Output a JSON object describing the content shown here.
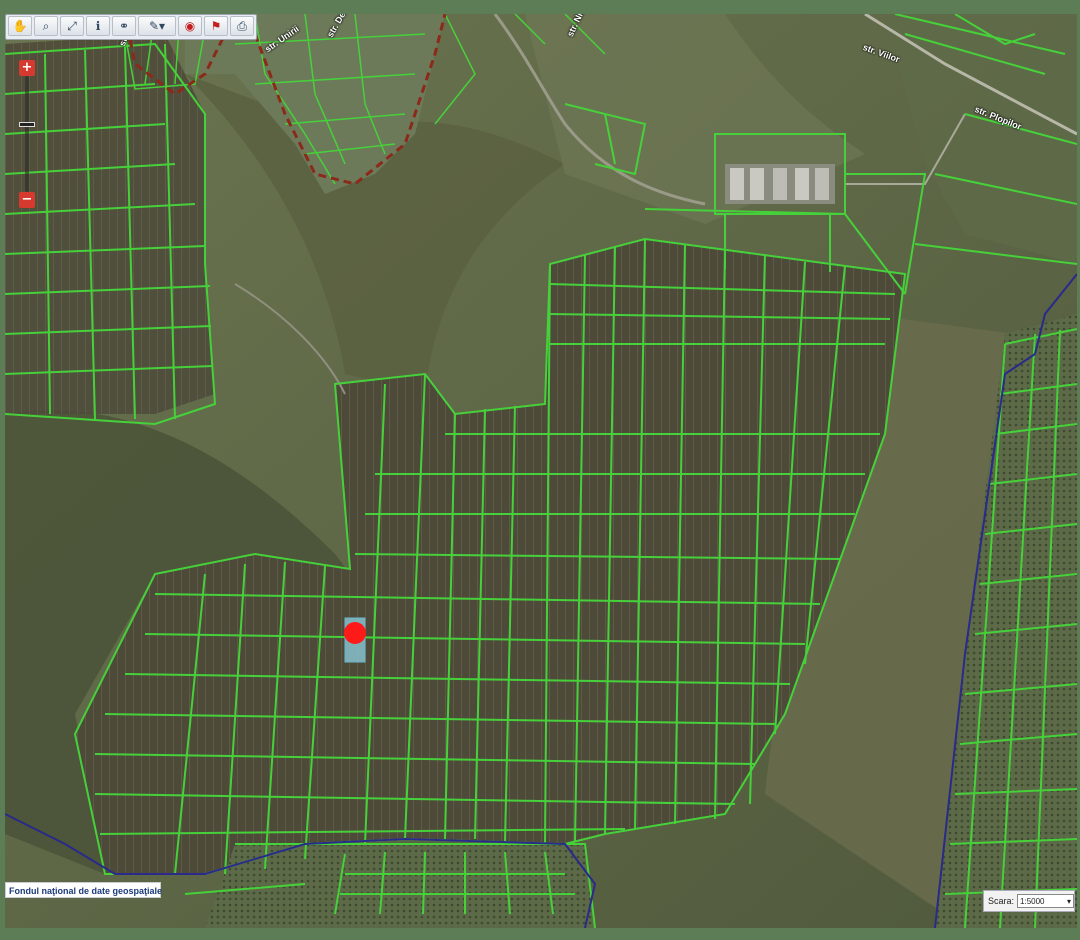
{
  "toolbar": {
    "tools": [
      {
        "name": "pan-tool",
        "glyph": "✋"
      },
      {
        "name": "identify-tool",
        "glyph": "⌕"
      },
      {
        "name": "full-extent-tool",
        "glyph": "⤢"
      },
      {
        "name": "info-tool",
        "glyph": "ℹ"
      },
      {
        "name": "binoculars-tool",
        "glyph": "⚭"
      },
      {
        "name": "measure-tool",
        "glyph": "✎▾"
      },
      {
        "name": "target-tool",
        "glyph": "◉"
      },
      {
        "name": "flag-tool",
        "glyph": "⚑"
      },
      {
        "name": "print-tool",
        "glyph": "⎙"
      }
    ]
  },
  "zoom": {
    "in_label": "+",
    "out_label": "−"
  },
  "map": {
    "road_labels": [
      "str. Pacii",
      "str. Unirii",
      "str. Deal",
      "str. Nistru",
      "str. Plopilor",
      "str. Viilor"
    ],
    "parcel_color": "#46d13a",
    "boundary_color": "#2a2a8a",
    "village_boundary_color": "#8b2a1a",
    "marker_color": "#ff1a1a",
    "selected_parcel_color": "#8fd0e0"
  },
  "attribution": {
    "text": "Fondul naţional de date geospaţiale"
  },
  "scale": {
    "label": "Scara:",
    "value": "1:5000"
  }
}
